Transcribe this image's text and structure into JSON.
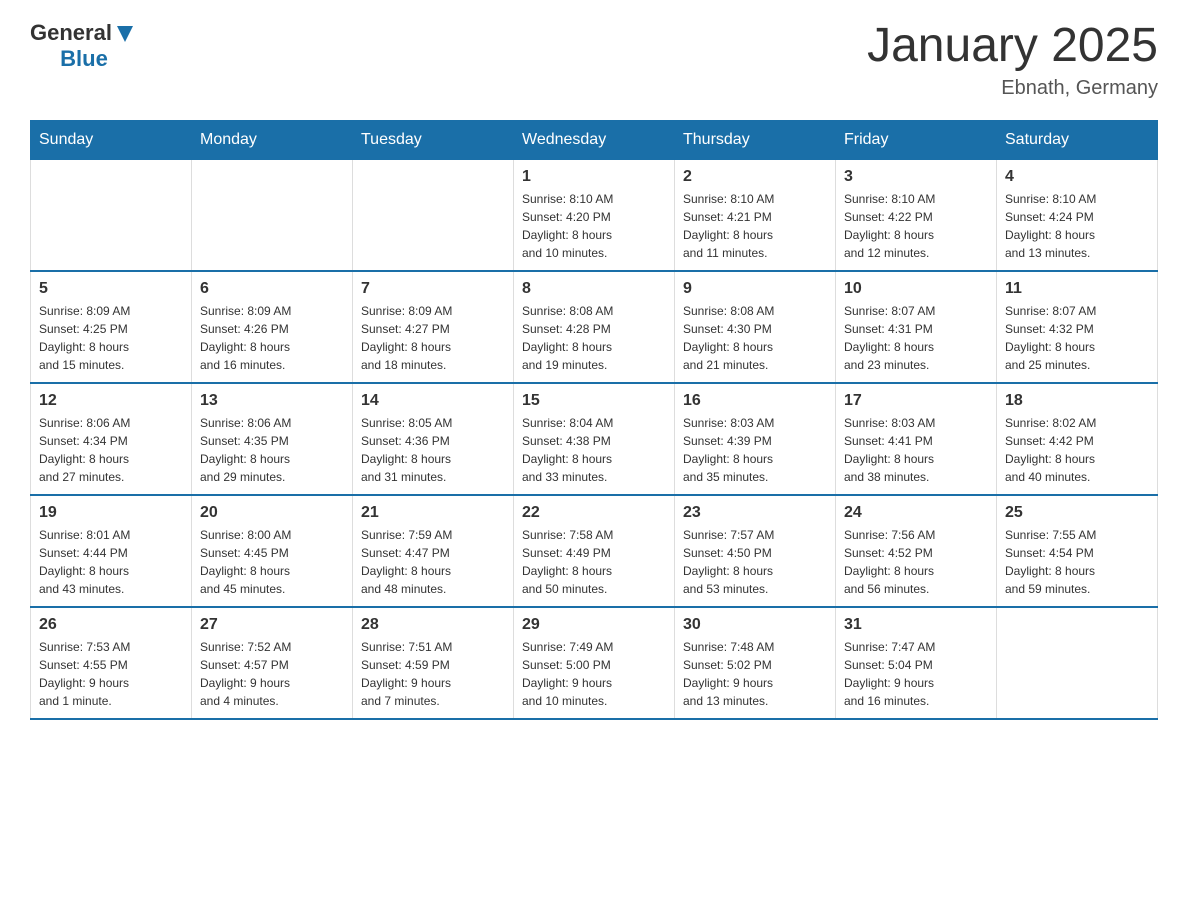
{
  "header": {
    "logo": {
      "general": "General",
      "blue": "Blue"
    },
    "title": "January 2025",
    "location": "Ebnath, Germany"
  },
  "days_of_week": [
    "Sunday",
    "Monday",
    "Tuesday",
    "Wednesday",
    "Thursday",
    "Friday",
    "Saturday"
  ],
  "weeks": [
    [
      {
        "day": "",
        "info": ""
      },
      {
        "day": "",
        "info": ""
      },
      {
        "day": "",
        "info": ""
      },
      {
        "day": "1",
        "info": "Sunrise: 8:10 AM\nSunset: 4:20 PM\nDaylight: 8 hours\nand 10 minutes."
      },
      {
        "day": "2",
        "info": "Sunrise: 8:10 AM\nSunset: 4:21 PM\nDaylight: 8 hours\nand 11 minutes."
      },
      {
        "day": "3",
        "info": "Sunrise: 8:10 AM\nSunset: 4:22 PM\nDaylight: 8 hours\nand 12 minutes."
      },
      {
        "day": "4",
        "info": "Sunrise: 8:10 AM\nSunset: 4:24 PM\nDaylight: 8 hours\nand 13 minutes."
      }
    ],
    [
      {
        "day": "5",
        "info": "Sunrise: 8:09 AM\nSunset: 4:25 PM\nDaylight: 8 hours\nand 15 minutes."
      },
      {
        "day": "6",
        "info": "Sunrise: 8:09 AM\nSunset: 4:26 PM\nDaylight: 8 hours\nand 16 minutes."
      },
      {
        "day": "7",
        "info": "Sunrise: 8:09 AM\nSunset: 4:27 PM\nDaylight: 8 hours\nand 18 minutes."
      },
      {
        "day": "8",
        "info": "Sunrise: 8:08 AM\nSunset: 4:28 PM\nDaylight: 8 hours\nand 19 minutes."
      },
      {
        "day": "9",
        "info": "Sunrise: 8:08 AM\nSunset: 4:30 PM\nDaylight: 8 hours\nand 21 minutes."
      },
      {
        "day": "10",
        "info": "Sunrise: 8:07 AM\nSunset: 4:31 PM\nDaylight: 8 hours\nand 23 minutes."
      },
      {
        "day": "11",
        "info": "Sunrise: 8:07 AM\nSunset: 4:32 PM\nDaylight: 8 hours\nand 25 minutes."
      }
    ],
    [
      {
        "day": "12",
        "info": "Sunrise: 8:06 AM\nSunset: 4:34 PM\nDaylight: 8 hours\nand 27 minutes."
      },
      {
        "day": "13",
        "info": "Sunrise: 8:06 AM\nSunset: 4:35 PM\nDaylight: 8 hours\nand 29 minutes."
      },
      {
        "day": "14",
        "info": "Sunrise: 8:05 AM\nSunset: 4:36 PM\nDaylight: 8 hours\nand 31 minutes."
      },
      {
        "day": "15",
        "info": "Sunrise: 8:04 AM\nSunset: 4:38 PM\nDaylight: 8 hours\nand 33 minutes."
      },
      {
        "day": "16",
        "info": "Sunrise: 8:03 AM\nSunset: 4:39 PM\nDaylight: 8 hours\nand 35 minutes."
      },
      {
        "day": "17",
        "info": "Sunrise: 8:03 AM\nSunset: 4:41 PM\nDaylight: 8 hours\nand 38 minutes."
      },
      {
        "day": "18",
        "info": "Sunrise: 8:02 AM\nSunset: 4:42 PM\nDaylight: 8 hours\nand 40 minutes."
      }
    ],
    [
      {
        "day": "19",
        "info": "Sunrise: 8:01 AM\nSunset: 4:44 PM\nDaylight: 8 hours\nand 43 minutes."
      },
      {
        "day": "20",
        "info": "Sunrise: 8:00 AM\nSunset: 4:45 PM\nDaylight: 8 hours\nand 45 minutes."
      },
      {
        "day": "21",
        "info": "Sunrise: 7:59 AM\nSunset: 4:47 PM\nDaylight: 8 hours\nand 48 minutes."
      },
      {
        "day": "22",
        "info": "Sunrise: 7:58 AM\nSunset: 4:49 PM\nDaylight: 8 hours\nand 50 minutes."
      },
      {
        "day": "23",
        "info": "Sunrise: 7:57 AM\nSunset: 4:50 PM\nDaylight: 8 hours\nand 53 minutes."
      },
      {
        "day": "24",
        "info": "Sunrise: 7:56 AM\nSunset: 4:52 PM\nDaylight: 8 hours\nand 56 minutes."
      },
      {
        "day": "25",
        "info": "Sunrise: 7:55 AM\nSunset: 4:54 PM\nDaylight: 8 hours\nand 59 minutes."
      }
    ],
    [
      {
        "day": "26",
        "info": "Sunrise: 7:53 AM\nSunset: 4:55 PM\nDaylight: 9 hours\nand 1 minute."
      },
      {
        "day": "27",
        "info": "Sunrise: 7:52 AM\nSunset: 4:57 PM\nDaylight: 9 hours\nand 4 minutes."
      },
      {
        "day": "28",
        "info": "Sunrise: 7:51 AM\nSunset: 4:59 PM\nDaylight: 9 hours\nand 7 minutes."
      },
      {
        "day": "29",
        "info": "Sunrise: 7:49 AM\nSunset: 5:00 PM\nDaylight: 9 hours\nand 10 minutes."
      },
      {
        "day": "30",
        "info": "Sunrise: 7:48 AM\nSunset: 5:02 PM\nDaylight: 9 hours\nand 13 minutes."
      },
      {
        "day": "31",
        "info": "Sunrise: 7:47 AM\nSunset: 5:04 PM\nDaylight: 9 hours\nand 16 minutes."
      },
      {
        "day": "",
        "info": ""
      }
    ]
  ]
}
